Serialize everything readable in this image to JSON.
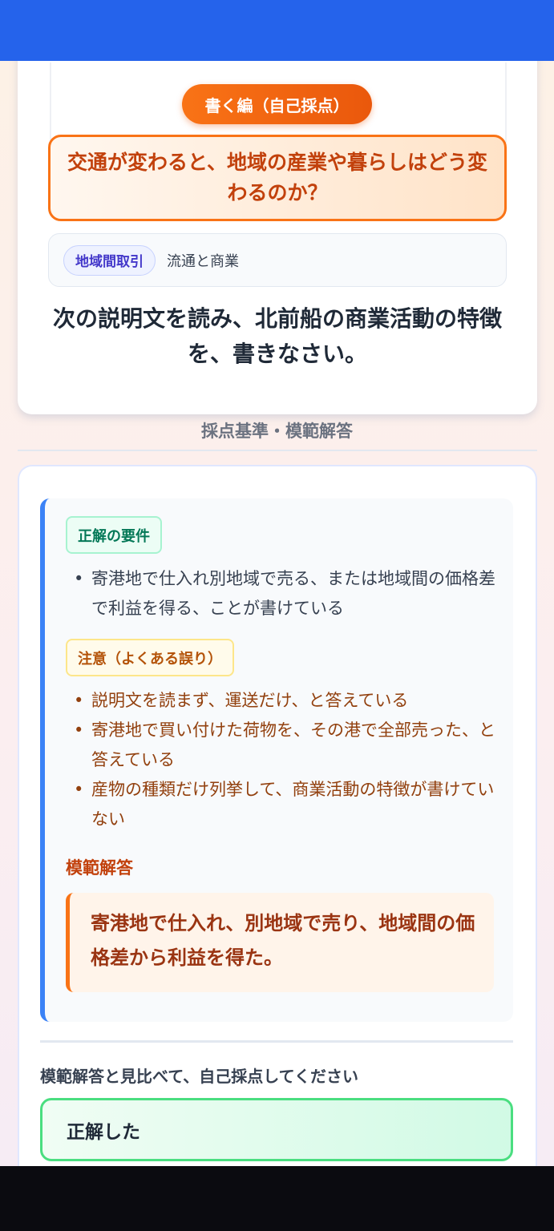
{
  "header": {
    "color": "#2563eb"
  },
  "question_card": {
    "mode_label": "書く編（自己採点）",
    "question": "交通が変わると、地域の産業や暮らしはどう変わるのか？",
    "tag": "地域間取引",
    "topic": "流通と商業",
    "instruction": "次の説明文を読み、北前船の商業活動の特徴を、書きなさい。"
  },
  "grading": {
    "section_title": "採点基準・模範解答",
    "requirements_label": "正解の要件",
    "requirements": [
      "寄港地で仕入れ別地域で売る、または地域間の価格差で利益を得る、ことが書けている"
    ],
    "cautions_label": "注意（よくある誤り）",
    "cautions": [
      "説明文を読まず、運送だけ、と答えている",
      "寄港地で買い付けた荷物を、その港で全部売った、と答えている",
      "産物の種類だけ列挙して、商業活動の特徴が書けていない"
    ],
    "model_label": "模範解答",
    "model_answer": "寄港地で仕入れ、別地域で売り、地域間の価格差から利益を得た。"
  },
  "self_grade": {
    "prompt": "模範解答と見比べて、自己採点してください",
    "correct_button": "正解した"
  },
  "colors": {
    "accent_orange": "#f97316",
    "accent_blue": "#3b82f6",
    "success_green": "#4ade80"
  }
}
